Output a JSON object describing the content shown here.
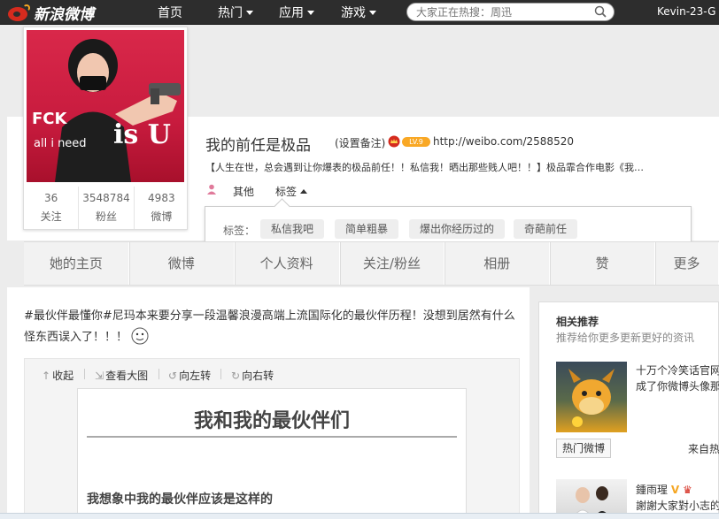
{
  "nav": {
    "logo": "新浪微博",
    "items": [
      {
        "label": "首页",
        "has_caret": false
      },
      {
        "label": "热门",
        "has_caret": true
      },
      {
        "label": "应用",
        "has_caret": true
      },
      {
        "label": "游戏",
        "has_caret": true
      }
    ],
    "search_placeholder": "大家正在热搜：周迅",
    "username": "Kevin-23-G"
  },
  "profile": {
    "avatar_text": [
      "FCK",
      "all i need",
      "is U"
    ],
    "stats": [
      {
        "value": "36",
        "label": "关注"
      },
      {
        "value": "3548784",
        "label": "粉丝"
      },
      {
        "value": "4983",
        "label": "微博"
      }
    ],
    "name": "我的前任是极品",
    "remark": "(设置备注)",
    "level": "LV.9",
    "url": "http://weibo.com/2588520",
    "bio": "【人生在世，总会遇到让你爆表的极品前任！！私信我！晒出那些贱人吧！！】极品霏合作电影《我…",
    "gender": "其他",
    "tag_toggle": "标签"
  },
  "tags": {
    "label": "标签：",
    "items": [
      "私信我吧",
      "简单粗暴",
      "爆出你经历过的",
      "奇葩前任"
    ]
  },
  "tabs": [
    "她的主页",
    "微博",
    "个人资料",
    "关注/粉丝",
    "相册",
    "赞",
    "更多"
  ],
  "post": {
    "text": "#最伙伴最懂你#尼玛本来要分享一段温馨浪漫高端上流国际化的最伙伴历程！没想到居然有什么怪东西误入了！！！",
    "tools": [
      "收起",
      "查看大图",
      "向左转",
      "向右转"
    ],
    "image_title": "我和我的最伙伴们",
    "image_subtitle": "我想象中我的最伙伴应该是这样的"
  },
  "sidebar": {
    "title": "相关推荐",
    "subtitle": "推荐给你更多更新更好的资讯",
    "item1_text": [
      "十万个冷笑话官网",
      "成了你微博头像那"
    ],
    "item1_button": "热门微博",
    "item1_source": "来自热",
    "item2_name": "鍾雨瑆",
    "item2_text": "謝謝大家對小志的"
  },
  "colors": {
    "topbar": "#2d2d2d",
    "accent_red": "#d52b1e",
    "level_badge": "#f9a825"
  }
}
